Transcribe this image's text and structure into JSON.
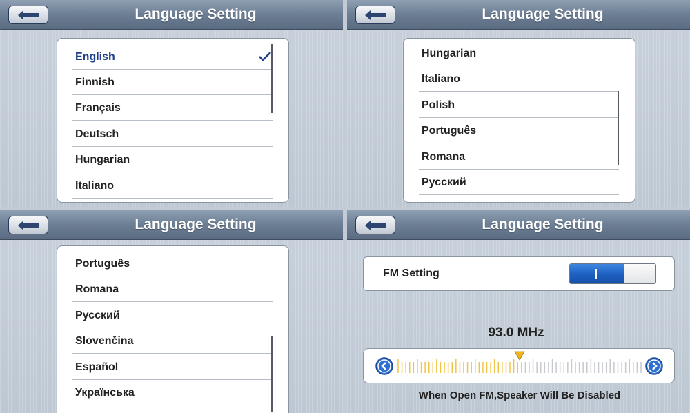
{
  "colors": {
    "selected_text": "#1e3f8c",
    "toggle_on": "#1f62c4",
    "tick_active": "#f0c44a",
    "tick_inactive": "#c6c9ce"
  },
  "screens": [
    {
      "title": "Language Setting",
      "items": [
        {
          "label": "English",
          "selected": true
        },
        {
          "label": "Finnish"
        },
        {
          "label": "Français"
        },
        {
          "label": "Deutsch"
        },
        {
          "label": "Hungarian"
        },
        {
          "label": "Italiano"
        }
      ]
    },
    {
      "title": "Language Setting",
      "items": [
        {
          "label": "Hungarian"
        },
        {
          "label": "Italiano"
        },
        {
          "label": "Polish"
        },
        {
          "label": "Português"
        },
        {
          "label": "Romana"
        },
        {
          "label": "Русский"
        }
      ]
    },
    {
      "title": "Language Setting",
      "items": [
        {
          "label": "Português"
        },
        {
          "label": "Romana"
        },
        {
          "label": "Русский"
        },
        {
          "label": "Slovenčina"
        },
        {
          "label": "Español"
        },
        {
          "label": "Українська"
        }
      ]
    },
    {
      "title": "Language Setting",
      "fm": {
        "label": "FM Setting",
        "toggle_state": "on",
        "frequency": "93.0 MHz",
        "tuner_position": 0.5,
        "note": "When Open FM,Speaker Will Be Disabled"
      }
    }
  ]
}
